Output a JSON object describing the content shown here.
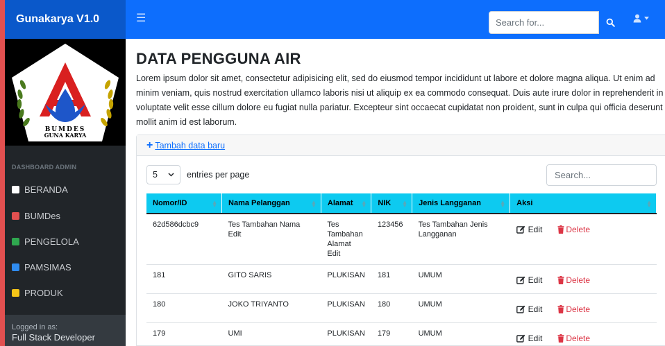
{
  "navbar": {
    "brand": "Gunakarya V1.0",
    "search_placeholder": "Search for...",
    "search_icon": "search-icon",
    "user_icon": "user-icon",
    "accent_color": "#0d6efd"
  },
  "sidebar": {
    "logo_text_line1": "BUMDES",
    "logo_text_line2": "GUNA KARYA",
    "heading": "DASHBOARD ADMIN",
    "items": [
      {
        "label": "BERANDA",
        "color": "#ffffff"
      },
      {
        "label": "BUMDes",
        "color": "#e25050"
      },
      {
        "label": "PENGELOLA",
        "color": "#2fa84f"
      },
      {
        "label": "PAMSIMAS",
        "color": "#2f8cf0"
      },
      {
        "label": "PRODUK",
        "color": "#f5c518"
      }
    ],
    "footer_small": "Logged in as:",
    "footer_name": "Full Stack Developer"
  },
  "main": {
    "title": "DATA PENGGUNA AIR",
    "intro": "Lorem ipsum dolor sit amet, consectetur adipisicing elit, sed do eiusmod tempor incididunt ut labore et dolore magna aliqua. Ut enim ad minim veniam, quis nostrud exercitation ullamco laboris nisi ut aliquip ex ea commodo consequat. Duis aute irure dolor in reprehenderit in voluptate velit esse cillum dolore eu fugiat nulla pariatur. Excepteur sint occaecat cupidatat non proident, sunt in culpa qui officia deserunt mollit anim id est laborum.",
    "add_link": "Tambah data baru",
    "per_page_value": "5",
    "per_page_label": "entries per page",
    "search_placeholder": "Search..."
  },
  "table": {
    "columns": [
      "Nomor/ID",
      "Nama Pelanggan",
      "Alamat",
      "NIK",
      "Jenis Langganan",
      "Aksi"
    ],
    "edit_label": "Edit",
    "delete_label": "Delete",
    "rows": [
      [
        "62d586dcbc9",
        "Tes Tambahan Nama Edit",
        "Tes Tambahan Alamat Edit",
        "123456",
        "Tes Tambahan Jenis Langganan"
      ],
      [
        "181",
        "GITO SARIS",
        "PLUKISAN",
        "181",
        "UMUM"
      ],
      [
        "180",
        "JOKO TRIYANTO",
        "PLUKISAN",
        "180",
        "UMUM"
      ],
      [
        "179",
        "UMI",
        "PLUKISAN",
        "179",
        "UMUM"
      ]
    ]
  }
}
